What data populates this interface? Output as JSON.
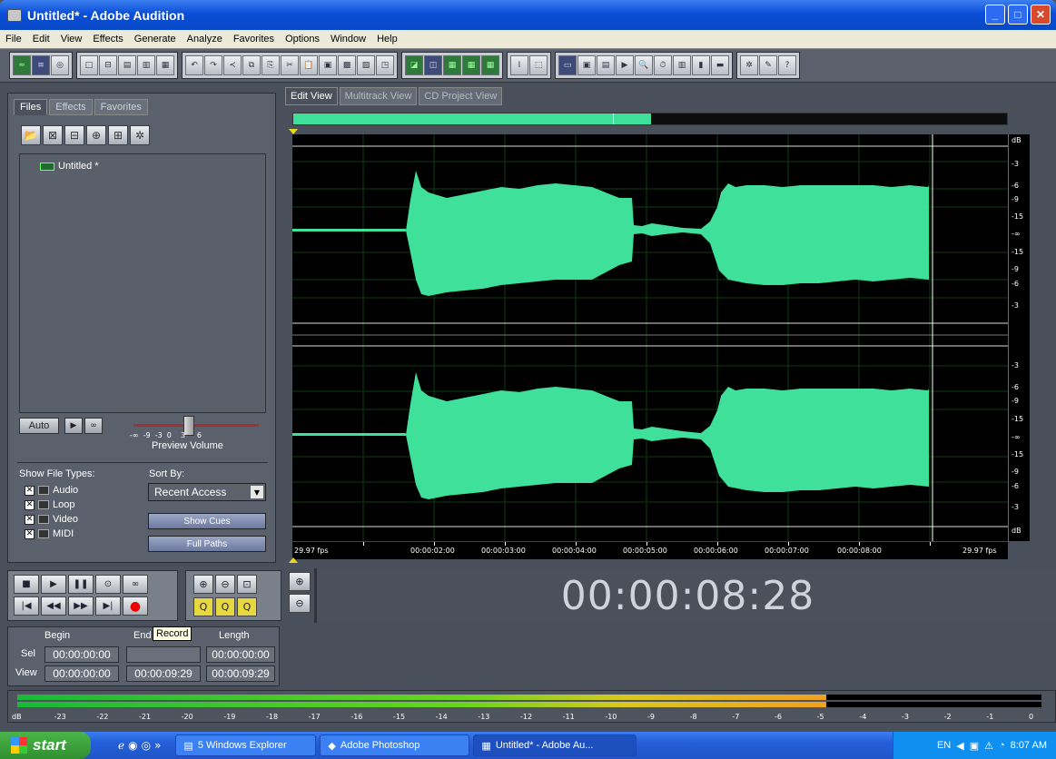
{
  "window": {
    "title": "Untitled* - Adobe Audition",
    "controls": [
      "_",
      "□",
      "✕"
    ]
  },
  "menu": [
    "File",
    "Edit",
    "View",
    "Effects",
    "Generate",
    "Analyze",
    "Favorites",
    "Options",
    "Window",
    "Help"
  ],
  "left_panel": {
    "tabs": [
      "Files",
      "Effects",
      "Favorites"
    ],
    "active_tab": "Files",
    "files": [
      {
        "name": "Untitled *"
      }
    ],
    "auto_label": "Auto",
    "preview_volume_label": "Preview Volume",
    "preview_ticks": "-∞  -9  -3  0    3     6",
    "show_file_types_label": "Show File Types:",
    "file_types": [
      {
        "label": "Audio",
        "checked": true
      },
      {
        "label": "Loop",
        "checked": true
      },
      {
        "label": "Video",
        "checked": true
      },
      {
        "label": "MIDI",
        "checked": true
      }
    ],
    "sort_by_label": "Sort By:",
    "sort_by_value": "Recent Access",
    "show_cues_label": "Show Cues",
    "full_paths_label": "Full Paths"
  },
  "editor": {
    "tabs": [
      "Edit View",
      "Multitrack View",
      "CD Project View"
    ],
    "active_tab": "Edit View",
    "db_labels_top": [
      "dB",
      "-3",
      "-6",
      "-9",
      "-15",
      "-∞",
      "-15",
      "-9",
      "-6",
      "-3"
    ],
    "db_labels_bottom": [
      "-3",
      "-6",
      "-9",
      "-15",
      "-∞",
      "-15",
      "-9",
      "-6",
      "-3",
      "dB"
    ],
    "fps_left": "29.97 fps",
    "fps_right": "29.97 fps",
    "time_labels": [
      "00:00:02:00",
      "00:00:03:00",
      "00:00:04:00",
      "00:00:05:00",
      "00:00:06:00",
      "00:00:07:00",
      "00:00:08:00"
    ],
    "waveform_color": "#3fe09a"
  },
  "transport": {
    "record_tooltip": "Record"
  },
  "time_display": "00:00:08:28",
  "selection": {
    "col_begin": "Begin",
    "col_end": "End",
    "col_length": "Length",
    "row_sel": "Sel",
    "row_view": "View",
    "sel_begin": "00:00:00:00",
    "sel_end": "",
    "sel_length": "00:00:00:00",
    "view_begin": "00:00:00:00",
    "view_end": "00:00:09:29",
    "view_length": "00:00:09:29"
  },
  "level_meter": {
    "ticks": [
      "dB",
      "-23",
      "-22",
      "-21",
      "-20",
      "-19",
      "-18",
      "-17",
      "-16",
      "-15",
      "-14",
      "-13",
      "-12",
      "-11",
      "-10",
      "-9",
      "-8",
      "-7",
      "-6",
      "-5",
      "-4",
      "-3",
      "-2",
      "-1",
      "0"
    ],
    "level_fraction": 0.79
  },
  "taskbar": {
    "start": "start",
    "tasks": [
      "5 Windows Explorer",
      "Adobe Photoshop",
      "Untitled* - Adobe Au..."
    ],
    "lang": "EN",
    "clock": "8:07 AM"
  }
}
